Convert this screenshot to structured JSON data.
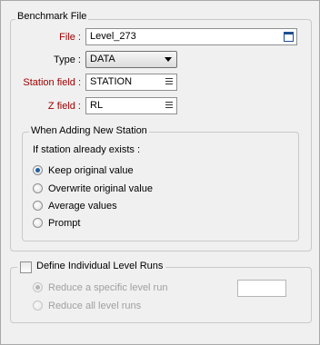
{
  "benchmark": {
    "title": "Benchmark File",
    "file_label": "File :",
    "file_value": "Level_273",
    "type_label": "Type :",
    "type_value": "DATA",
    "station_label": "Station field :",
    "station_value": "STATION",
    "z_label": "Z field :",
    "z_value": "RL"
  },
  "new_station": {
    "title": "When Adding New Station",
    "prompt": "If station already exists :",
    "options": [
      {
        "label": "Keep original value",
        "checked": true
      },
      {
        "label": "Overwrite original value",
        "checked": false
      },
      {
        "label": "Average values",
        "checked": false
      },
      {
        "label": "Prompt",
        "checked": false
      }
    ]
  },
  "level_runs": {
    "checkbox_label": "Define Individual Level Runs",
    "checked": false,
    "options": [
      {
        "label": "Reduce a specific level run",
        "checked": true
      },
      {
        "label": "Reduce all level runs",
        "checked": false
      }
    ],
    "run_value": ""
  },
  "colors": {
    "required_label": "#a00000",
    "disabled_text": "#a0a0a0"
  },
  "icons": {
    "file_browse": "file-browse-icon",
    "field_list": "field-list-icon",
    "dropdown": "dropdown-arrow-icon"
  }
}
